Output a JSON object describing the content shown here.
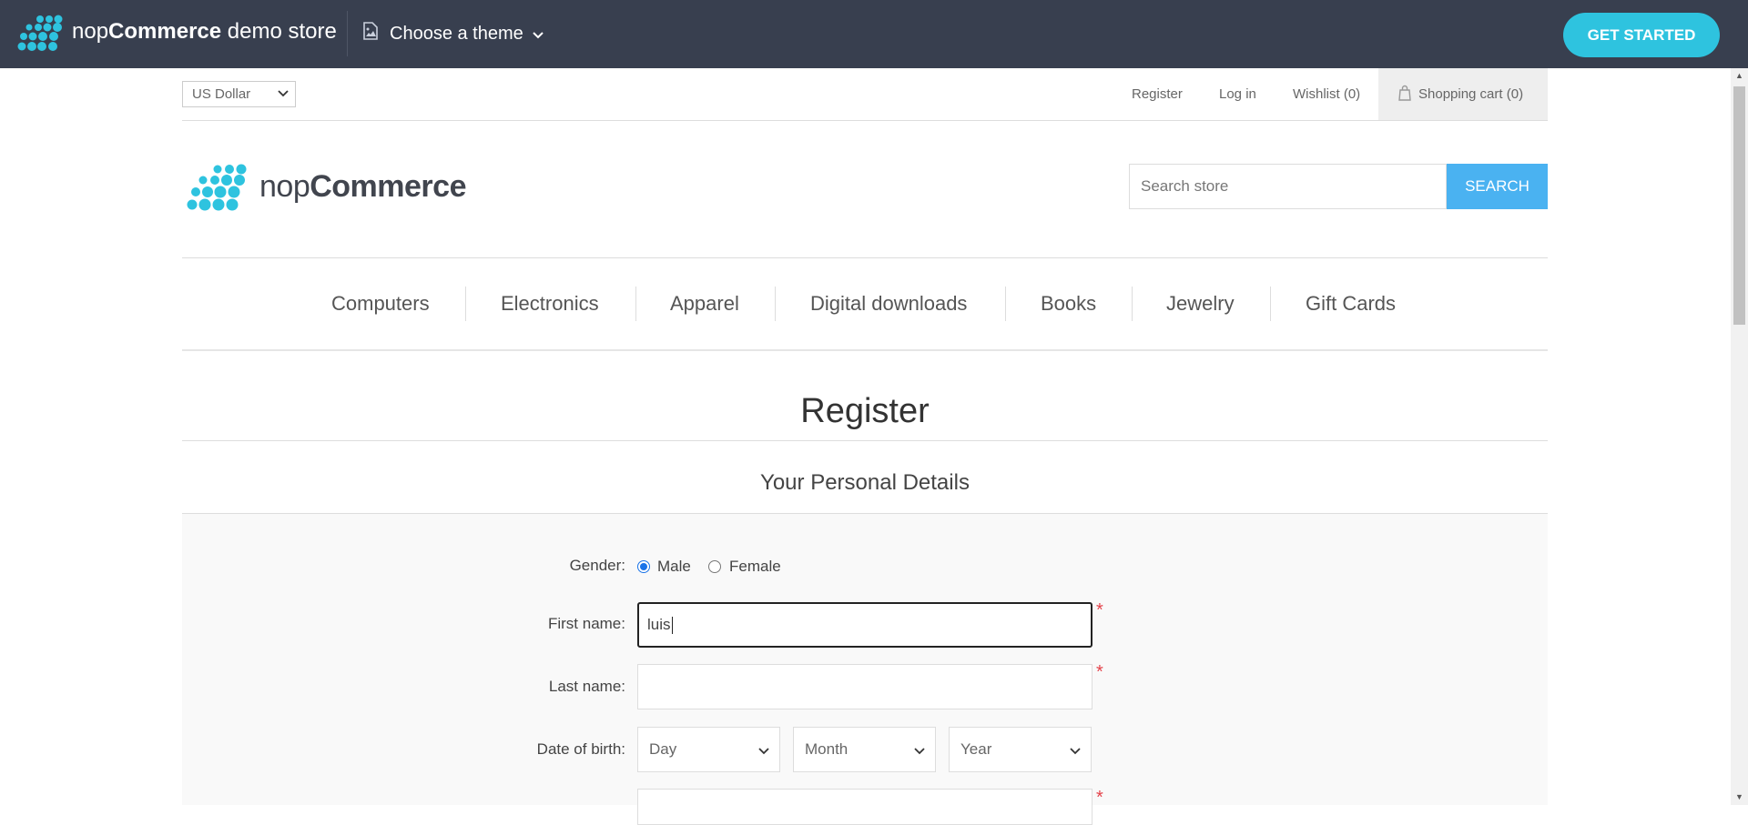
{
  "demo_bar": {
    "brand_bold": "nop",
    "brand_bold2": "Commerce",
    "brand_rest": " demo store",
    "theme_label": "Choose a theme",
    "get_started": "GET STARTED",
    "bg_color": "#383f4f",
    "accent_color": "#2ec3df"
  },
  "header": {
    "currency": "US Dollar",
    "links": {
      "register": "Register",
      "login": "Log in",
      "wishlist": "Wishlist (0)",
      "cart": "Shopping cart (0)"
    },
    "logo_text_light": "nop",
    "logo_text_bold": "Commerce",
    "search_placeholder": "Search store",
    "search_button": "SEARCH",
    "search_button_color": "#4ab2f1"
  },
  "nav": {
    "items": [
      "Computers",
      "Electronics",
      "Apparel",
      "Digital downloads",
      "Books",
      "Jewelry",
      "Gift Cards"
    ]
  },
  "page": {
    "title": "Register",
    "section_title": "Your Personal Details"
  },
  "form": {
    "gender_label": "Gender:",
    "gender_male": "Male",
    "gender_female": "Female",
    "gender_selected": "Male",
    "first_name_label": "First name:",
    "first_name_value": "luis",
    "last_name_label": "Last name:",
    "last_name_value": "",
    "dob_label": "Date of birth:",
    "dob_day": "Day",
    "dob_month": "Month",
    "dob_year": "Year",
    "required_mark": "*"
  }
}
